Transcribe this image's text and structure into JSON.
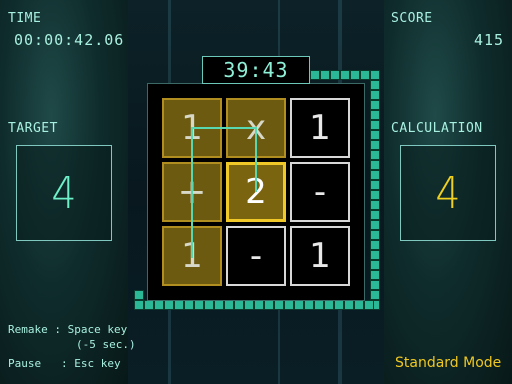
{
  "time": {
    "label": "TIME",
    "value": "00:00:42.06"
  },
  "score": {
    "label": "SCORE",
    "value": "415"
  },
  "target": {
    "label": "TARGET",
    "value": "4"
  },
  "calculation": {
    "label": "CALCULATION",
    "value": "4"
  },
  "countdown": "39:43",
  "board": [
    [
      "1",
      "x",
      "1"
    ],
    [
      "+",
      "2",
      "-"
    ],
    [
      "1",
      "-",
      "1"
    ]
  ],
  "help": {
    "remake": "Remake : Space key",
    "remake_note": "(-5 sec.)",
    "pause": "Pause   : Esc key"
  },
  "mode": "Standard Mode",
  "colors": {
    "accent": "#a8f0e0",
    "selected": "#6b5a10",
    "cursor": "#f0c828",
    "target": "#6ef0c8",
    "calc": "#f0d020"
  }
}
